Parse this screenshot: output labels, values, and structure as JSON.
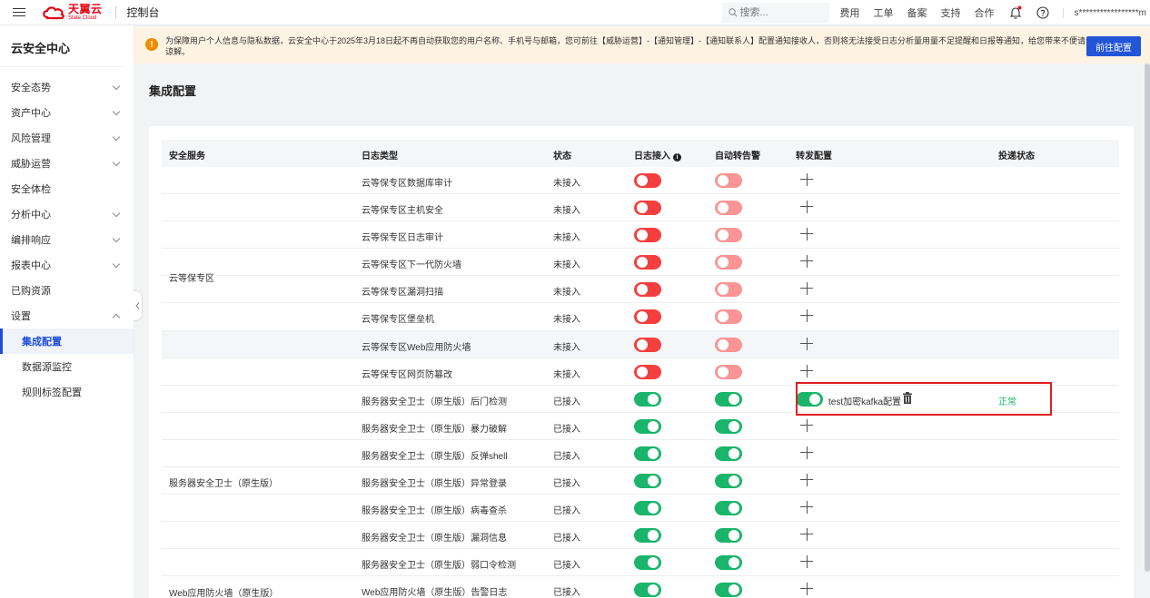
{
  "topbar": {
    "logo_cn": "天翼云",
    "logo_en": "State Cloud",
    "console_label": "控制台",
    "search_placeholder": "搜索...",
    "links": [
      "费用",
      "工单",
      "备案",
      "支持",
      "合作"
    ],
    "account": "s*****************m"
  },
  "sidebar": {
    "title": "云安全中心",
    "items": [
      {
        "label": "安全态势",
        "expandable": true
      },
      {
        "label": "资产中心",
        "expandable": true
      },
      {
        "label": "风险管理",
        "expandable": true
      },
      {
        "label": "威胁运营",
        "expandable": true
      },
      {
        "label": "安全体检",
        "expandable": false
      },
      {
        "label": "分析中心",
        "expandable": true
      },
      {
        "label": "编排响应",
        "expandable": true
      },
      {
        "label": "报表中心",
        "expandable": true
      },
      {
        "label": "已购资源",
        "expandable": false
      },
      {
        "label": "设置",
        "expandable": true,
        "expanded": true
      }
    ],
    "sub_items": [
      "集成配置",
      "数据源监控",
      "规则标签配置"
    ],
    "active_sub": "集成配置"
  },
  "notice": {
    "icon": "!",
    "text": "为保障用户个人信息与隐私数据，云安全中心于2025年3月18日起不再自动获取您的用户名称、手机号与邮箱，您可前往【威胁运营】-【通知管理】-【通知联系人】配置通知接收人，否则将无法接受日志分析量用量不足提醒和日报等通知，给您带来不便请谅解。",
    "button": "前往配置"
  },
  "page_title": "集成配置",
  "table": {
    "headers": {
      "service": "安全服务",
      "log_type": "日志类型",
      "status": "状态",
      "log_access": "日志接入",
      "auto_alert": "自动转告警",
      "forward": "转发配置",
      "delivery": "投递状态"
    },
    "groups": [
      {
        "name": "云等保专区",
        "start": 0,
        "count": 8
      },
      {
        "name": "服务器安全卫士（原生版）",
        "start": 8,
        "count": 7
      },
      {
        "name": "Web应用防火墙（原生版）",
        "start": 15,
        "count": 1
      }
    ],
    "rows": [
      {
        "log_type": "云等保专区数据库审计",
        "status": "未接入",
        "log_on": false,
        "alert_on": false
      },
      {
        "log_type": "云等保专区主机安全",
        "status": "未接入",
        "log_on": false,
        "alert_on": false
      },
      {
        "log_type": "云等保专区日志审计",
        "status": "未接入",
        "log_on": false,
        "alert_on": false
      },
      {
        "log_type": "云等保专区下一代防火墙",
        "status": "未接入",
        "log_on": false,
        "alert_on": false
      },
      {
        "log_type": "云等保专区漏洞扫描",
        "status": "未接入",
        "log_on": false,
        "alert_on": false
      },
      {
        "log_type": "云等保专区堡垒机",
        "status": "未接入",
        "log_on": false,
        "alert_on": false
      },
      {
        "log_type": "云等保专区Web应用防火墙",
        "status": "未接入",
        "log_on": false,
        "alert_on": false,
        "highlight": true
      },
      {
        "log_type": "云等保专区网页防篡改",
        "status": "未接入",
        "log_on": false,
        "alert_on": false
      },
      {
        "log_type": "服务器安全卫士（原生版）后门检测",
        "status": "已接入",
        "log_on": true,
        "alert_on": true,
        "forward": {
          "enabled": true,
          "name": "test加密kafka配置"
        },
        "delivery": "正常"
      },
      {
        "log_type": "服务器安全卫士（原生版）暴力破解",
        "status": "已接入",
        "log_on": true,
        "alert_on": true
      },
      {
        "log_type": "服务器安全卫士（原生版）反弹shell",
        "status": "已接入",
        "log_on": true,
        "alert_on": true
      },
      {
        "log_type": "服务器安全卫士（原生版）异常登录",
        "status": "已接入",
        "log_on": true,
        "alert_on": true
      },
      {
        "log_type": "服务器安全卫士（原生版）病毒查杀",
        "status": "已接入",
        "log_on": true,
        "alert_on": true
      },
      {
        "log_type": "服务器安全卫士（原生版）漏洞信息",
        "status": "已接入",
        "log_on": true,
        "alert_on": true
      },
      {
        "log_type": "服务器安全卫士（原生版）弱口令检测",
        "status": "已接入",
        "log_on": true,
        "alert_on": true
      },
      {
        "log_type": "Web应用防火墙（原生版）告警日志",
        "status": "已接入",
        "log_on": true,
        "alert_on": true
      }
    ]
  },
  "colors": {
    "brand_red": "#e60012",
    "primary_blue": "#2355d8",
    "toggle_off": "#f53f3f",
    "toggle_off_disabled": "#fb9494",
    "toggle_on": "#1ab56b",
    "notice_bg": "#fdf3e3"
  }
}
